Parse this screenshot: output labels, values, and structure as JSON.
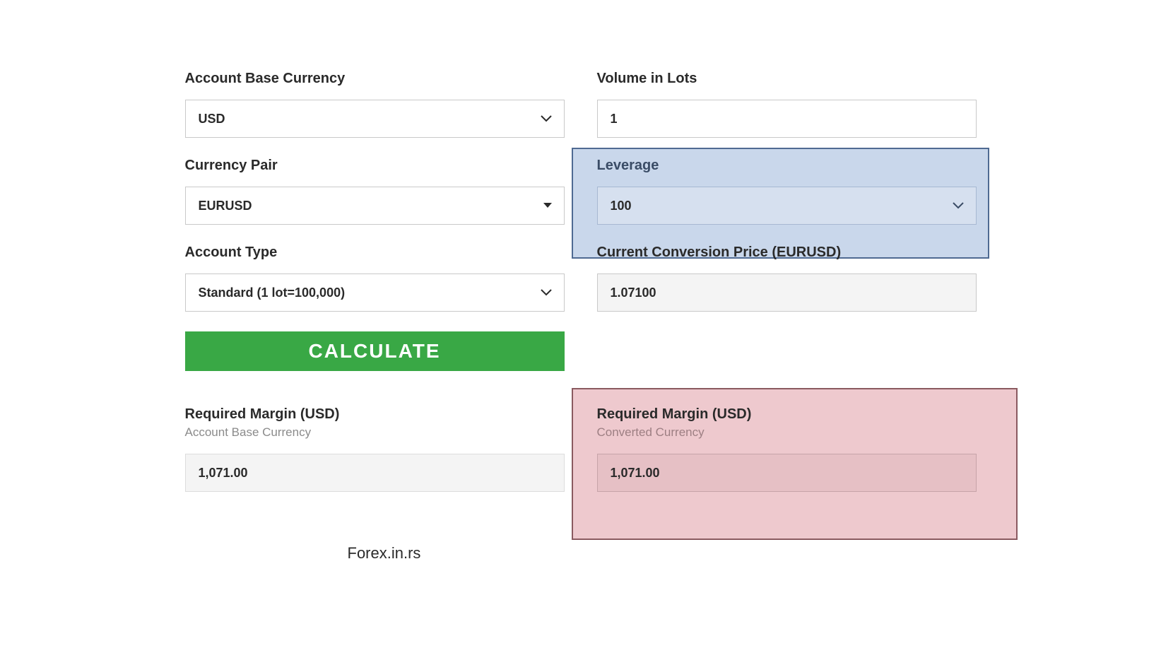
{
  "fields": {
    "account_base_currency": {
      "label": "Account Base Currency",
      "value": "USD"
    },
    "volume_in_lots": {
      "label": "Volume in Lots",
      "value": "1"
    },
    "currency_pair": {
      "label": "Currency Pair",
      "value": "EURUSD"
    },
    "leverage": {
      "label": "Leverage",
      "value": "100"
    },
    "account_type": {
      "label": "Account Type",
      "value": "Standard (1 lot=100,000)"
    },
    "conversion_price": {
      "label": "Current Conversion Price (EURUSD)",
      "value": "1.07100"
    }
  },
  "calculate_label": "CALCULATE",
  "results": {
    "base": {
      "label": "Required Margin (USD)",
      "sublabel": "Account Base Currency",
      "value": "1,071.00"
    },
    "converted": {
      "label": "Required Margin (USD)",
      "sublabel": "Converted Currency",
      "value": "1,071.00"
    }
  },
  "footer": "Forex.in.rs"
}
